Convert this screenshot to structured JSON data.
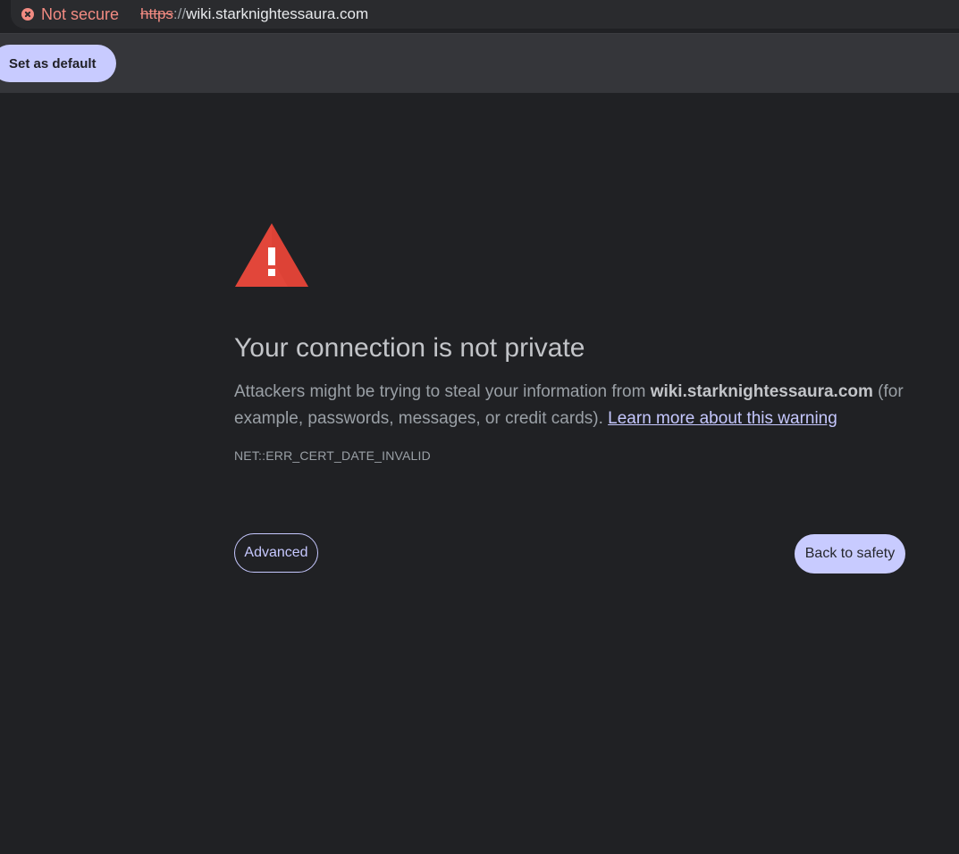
{
  "address_bar": {
    "security_label": "Not secure",
    "security_icon": "error-circle-icon",
    "url_scheme": "https",
    "url_separator": "://",
    "url_host": "wiki.starknightessaura.com"
  },
  "infobar": {
    "default_button_label": "Set as default"
  },
  "interstitial": {
    "warning_icon": "warning-triangle-icon",
    "title": "Your connection is not private",
    "description_before": "Attackers might be trying to steal your information from ",
    "description_host": "wiki.starknightessaura.com",
    "description_after": " (for example, passwords, messages, or credit cards). ",
    "learn_more_link": "Learn more about this warning",
    "error_code": "NET::ERR_CERT_DATE_INVALID",
    "advanced_button": "Advanced",
    "back_button": "Back to safety"
  },
  "colors": {
    "background": "#202124",
    "warning_red": "#e2463a",
    "not_secure_red": "#f28b82",
    "accent": "#c8cbff"
  }
}
